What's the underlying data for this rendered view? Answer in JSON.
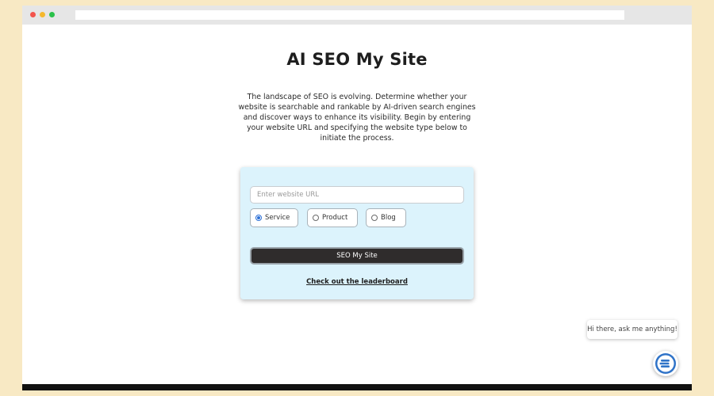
{
  "browser": {
    "url": ""
  },
  "page": {
    "title": "AI SEO My Site",
    "intro": "The landscape of SEO is evolving. Determine whether your website is searchable and rankable by AI-driven search engines and discover ways to enhance its visibility. Begin by entering your website URL and specifying the website type below to initiate the process."
  },
  "form": {
    "url_placeholder": "Enter website URL",
    "url_value": "",
    "types": [
      {
        "label": "Service",
        "selected": true
      },
      {
        "label": "Product",
        "selected": false
      },
      {
        "label": "Blog",
        "selected": false
      }
    ],
    "submit_label": "SEO My Site",
    "leaderboard_link": "Check out the leaderboard"
  },
  "chat": {
    "greeting": "Hi there, ask me anything!",
    "launcher_icon": "e-logo-icon"
  },
  "colors": {
    "accent": "#2b6fd6",
    "card_background": "#dcf3fc",
    "button_background": "#2f2c2c",
    "page_background": "#f8e9c4"
  }
}
